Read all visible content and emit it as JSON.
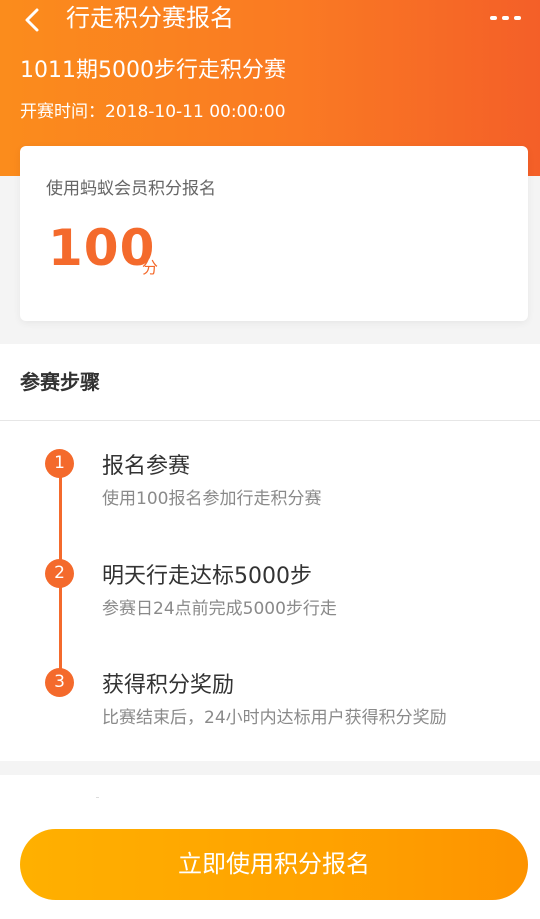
{
  "nav": {
    "title": "行走积分赛报名",
    "back_icon": "chevron-left-icon",
    "more_icon": "more-dots-icon"
  },
  "event": {
    "name": "1011期5000步行走积分赛",
    "start_time": "开赛时间：2018-10-11 00:00:00"
  },
  "points_card": {
    "label": "使用蚂蚁会员积分报名",
    "value": "100",
    "unit": "分"
  },
  "steps": {
    "title": "参赛步骤",
    "items": [
      {
        "num": "1",
        "title": "报名参赛",
        "desc": "使用100报名参加行走积分赛"
      },
      {
        "num": "2",
        "title": "明天行走达标5000步",
        "desc": "参赛日24点前完成5000步行走"
      },
      {
        "num": "3",
        "title": "获得积分奖励",
        "desc": "比赛结束后，24小时内达标用户获得积分奖励"
      }
    ]
  },
  "action": {
    "register_label": "立即使用积分报名"
  },
  "colors": {
    "accent": "#f46a2c",
    "header_start": "#fb8c1c",
    "header_end": "#f45f28",
    "button_start": "#ffb000",
    "button_end": "#fd9300"
  }
}
